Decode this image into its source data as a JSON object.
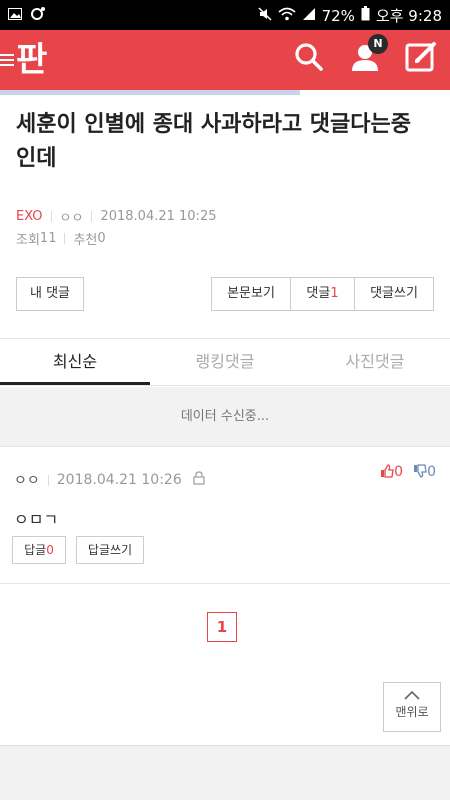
{
  "statusbar": {
    "battery": "72%",
    "time": "오후 9:28"
  },
  "appbar": {
    "logo": "판",
    "notification_badge": "N"
  },
  "post": {
    "title": "세훈이 인별에 종대 사과하라고 댓글다는중 인데",
    "category": "EXO",
    "author": "ㅇㅇ",
    "datetime": "2018.04.21 10:25",
    "views_label": "조회",
    "views": "11",
    "recommend_label": "추천",
    "recommend": "0"
  },
  "actions": {
    "my_comments": "내 댓글",
    "view_original": "본문보기",
    "comments_label": "댓글",
    "comments_count": "1",
    "write_comment": "댓글쓰기"
  },
  "tabs": [
    {
      "label": "최신순",
      "active": true
    },
    {
      "label": "랭킹댓글",
      "active": false
    },
    {
      "label": "사진댓글",
      "active": false
    }
  ],
  "loading_text": "데이터 수신중...",
  "comment": {
    "author": "ㅇㅇ",
    "datetime": "2018.04.21 10:26",
    "upvotes": "0",
    "downvotes": "0",
    "body": "ㅇㅁㄱ",
    "reply_label": "답글",
    "reply_count": "0",
    "write_reply": "답글쓰기"
  },
  "pagination": {
    "current": "1"
  },
  "to_top": "맨위로",
  "colors": {
    "brand": "#e8454a",
    "text": "#222222",
    "muted": "#999999"
  }
}
